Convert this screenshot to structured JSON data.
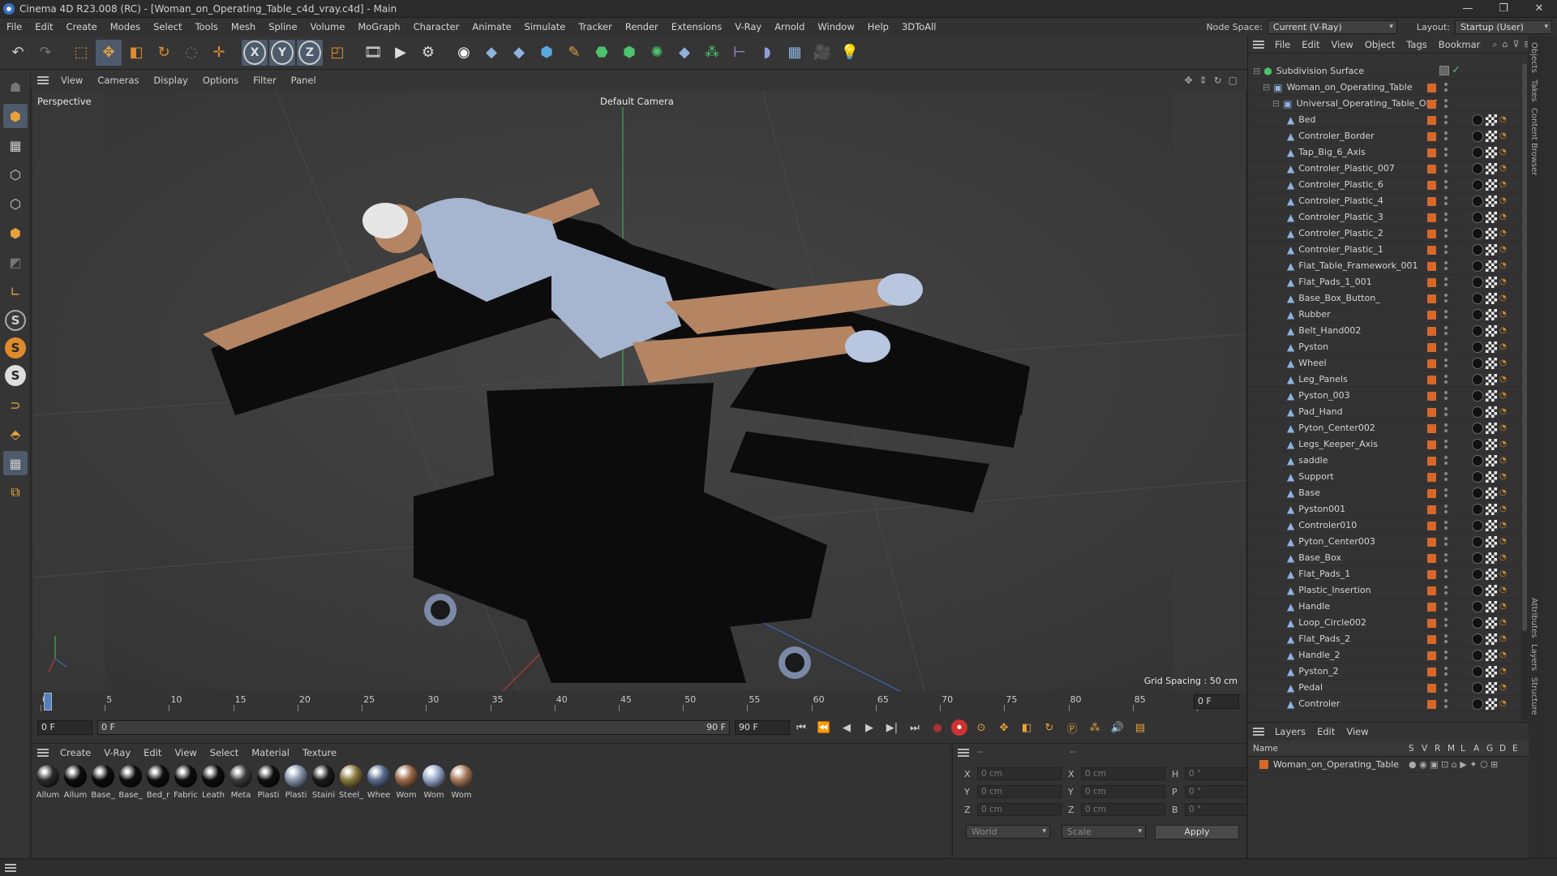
{
  "window": {
    "title": "Cinema 4D R23.008 (RC) - [Woman_on_Operating_Table_c4d_vray.c4d] - Main",
    "controls": [
      "—",
      "❐",
      "✕"
    ]
  },
  "menu": [
    "File",
    "Edit",
    "Create",
    "Modes",
    "Select",
    "Tools",
    "Mesh",
    "Spline",
    "Volume",
    "MoGraph",
    "Character",
    "Animate",
    "Simulate",
    "Tracker",
    "Render",
    "Extensions",
    "V-Ray",
    "Arnold",
    "Window",
    "Help",
    "3DToAll"
  ],
  "nodespace": {
    "label": "Node Space:",
    "value": "Current (V-Ray)",
    "layout_label": "Layout:",
    "layout_value": "Startup (User)"
  },
  "toolbar": {
    "x_label": "X",
    "y_label": "Y",
    "z_label": "Z"
  },
  "viewport": {
    "menu": [
      "View",
      "Cameras",
      "Display",
      "Options",
      "Filter",
      "Panel"
    ],
    "label": "Perspective",
    "camera": "Default Camera",
    "grid": "Grid Spacing : 50 cm"
  },
  "timeline": {
    "ticks": [
      "0",
      "5",
      "10",
      "15",
      "20",
      "25",
      "30",
      "35",
      "40",
      "45",
      "50",
      "55",
      "60",
      "65",
      "70",
      "75",
      "80",
      "85",
      "90"
    ],
    "frame_right": "0 F",
    "start": "0 F",
    "range_left": "0 F",
    "range_right": "90 F",
    "end": "90 F"
  },
  "materials": {
    "menu": [
      "Create",
      "V-Ray",
      "Edit",
      "View",
      "Select",
      "Material",
      "Texture"
    ],
    "items": [
      {
        "name": "Allum",
        "color": "#2a2a2a"
      },
      {
        "name": "Allum",
        "color": "#0d0d0d"
      },
      {
        "name": "Base_",
        "color": "#0d0d0d"
      },
      {
        "name": "Base_",
        "color": "#0d0d0d"
      },
      {
        "name": "Bed_r",
        "color": "#0d0d0d"
      },
      {
        "name": "Fabric",
        "color": "#0d0d0d"
      },
      {
        "name": "Leath",
        "color": "#0d0d0d"
      },
      {
        "name": "Meta",
        "color": "#3a3a3a"
      },
      {
        "name": "Plasti",
        "color": "#101010"
      },
      {
        "name": "Plasti",
        "color": "#8593ab"
      },
      {
        "name": "Staini",
        "color": "#1b1b1b"
      },
      {
        "name": "Steel_",
        "color": "#8a7a3c"
      },
      {
        "name": "Whee",
        "color": "#596c8c"
      },
      {
        "name": "Wom",
        "color": "#9b6a4a"
      },
      {
        "name": "Wom",
        "color": "#95a7c8"
      },
      {
        "name": "Wom",
        "color": "#a8785a"
      }
    ]
  },
  "coords": {
    "header": "--",
    "rows": [
      {
        "a": "X",
        "av": "0 cm",
        "b": "X",
        "bv": "0 cm",
        "c": "H",
        "cv": "0 °"
      },
      {
        "a": "Y",
        "av": "0 cm",
        "b": "Y",
        "bv": "0 cm",
        "c": "P",
        "cv": "0 °"
      },
      {
        "a": "Z",
        "av": "0 cm",
        "b": "Z",
        "bv": "0 cm",
        "c": "B",
        "cv": "0 °"
      }
    ],
    "world": "World",
    "scale": "Scale",
    "apply": "Apply"
  },
  "objects": {
    "menu": [
      "File",
      "Edit",
      "View",
      "Object",
      "Tags",
      "Bookmar"
    ],
    "root": "Subdivision Surface",
    "child": "Woman_on_Operating_Table",
    "group": "Universal_Operating_Table_OPT",
    "items": [
      "Bed",
      "Controler_Border",
      "Tap_Big_6_Axis",
      "Controler_Plastic_007",
      "Controler_Plastic_6",
      "Controler_Plastic_4",
      "Controler_Plastic_3",
      "Controler_Plastic_2",
      "Controler_Plastic_1",
      "Flat_Table_Framework_001",
      "Flat_Pads_1_001",
      "Base_Box_Button_",
      "Rubber",
      "Belt_Hand002",
      "Pyston",
      "Wheel",
      "Leg_Panels",
      "Pyston_003",
      "Pad_Hand",
      "Pyton_Center002",
      "Legs_Keeper_Axis",
      "saddle",
      "Support",
      "Base",
      "Pyston001",
      "Controler010",
      "Pyton_Center003",
      "Base_Box",
      "Flat_Pads_1",
      "Plastic_Insertion",
      "Handle",
      "Loop_Circle002",
      "Flat_Pads_2",
      "Handle_2",
      "Pyston_2",
      "Pedal",
      "Controler"
    ]
  },
  "sidetabs": [
    "Objects",
    "Takes",
    "Content Browser"
  ],
  "layers": {
    "menu": [
      "Layers",
      "Edit",
      "View"
    ],
    "columns": [
      "Name",
      "S",
      "V",
      "R",
      "M",
      "L",
      "A",
      "G",
      "D",
      "E"
    ],
    "item": "Woman_on_Operating_Table",
    "sidetabs": [
      "Attributes",
      "Layers",
      "Structure"
    ]
  },
  "colors": {
    "accent": "#4d5b6c",
    "layer": "#d8672a",
    "axis_x": "#c83c3c",
    "axis_y": "#3cc850",
    "axis_z": "#3c78c8"
  }
}
